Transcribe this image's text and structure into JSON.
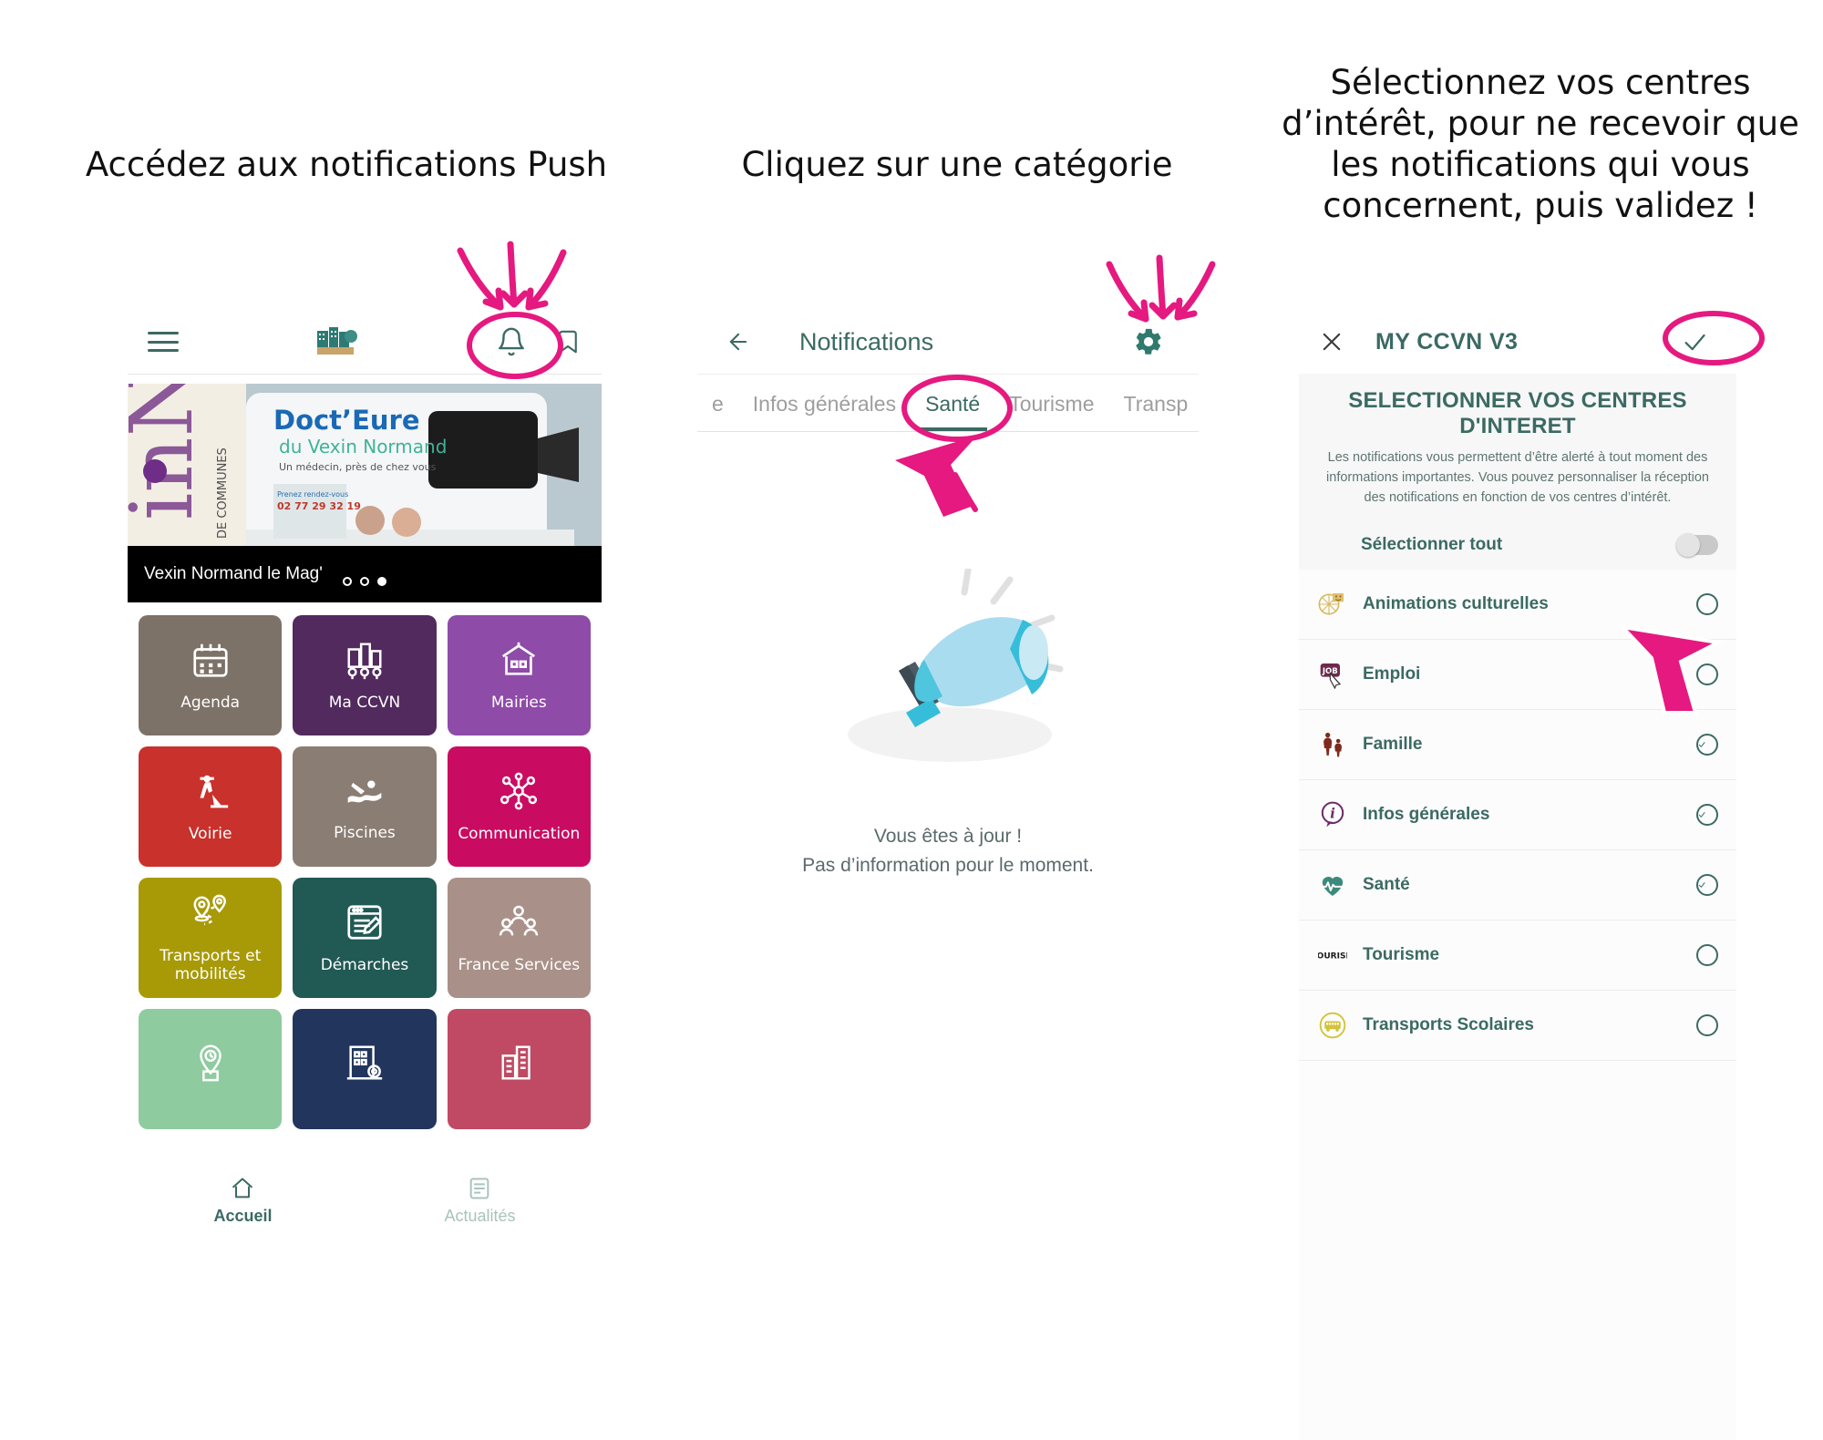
{
  "captions": {
    "step1": "Accédez aux notifications Push",
    "step2": "Cliquez sur une catégorie",
    "step3": "Sélectionnez vos centres d’intérêt, pour ne recevoir que les notifications qui vous concernent, puis validez !"
  },
  "colors": {
    "teal": "#3b6a63",
    "annotation_pink": "#e5197f",
    "tab_inactive": "#9e9e9e"
  },
  "phone1": {
    "hero": {
      "title": "Vexin Normand le Mag'",
      "dots": 3,
      "active_dot": 3
    },
    "tiles": [
      {
        "label": "Agenda",
        "color": "#7d7268",
        "icon": "calendar-icon"
      },
      {
        "label": "Ma CCVN",
        "color": "#522a5e",
        "icon": "city-icon"
      },
      {
        "label": "Mairies",
        "color": "#8e4ba8",
        "icon": "townhall-icon"
      },
      {
        "label": "Voirie",
        "color": "#c9312c",
        "icon": "roadworks-icon"
      },
      {
        "label": "Piscines",
        "color": "#8a7d73",
        "icon": "swimmer-icon"
      },
      {
        "label": "Communication",
        "color": "#c90c62",
        "icon": "network-icon"
      },
      {
        "label": "Transports et mobilités",
        "color": "#a89a07",
        "icon": "route-pin-icon"
      },
      {
        "label": "Démarches",
        "color": "#215954",
        "icon": "form-edit-icon"
      },
      {
        "label": "France Services",
        "color": "#a99189",
        "icon": "people-icon"
      },
      {
        "label": "",
        "color": "#8ecb9f",
        "icon": "pin-clock-icon"
      },
      {
        "label": "",
        "color": "#22365d",
        "icon": "building-icon"
      },
      {
        "label": "",
        "color": "#c04a63",
        "icon": "buildings-icon"
      }
    ],
    "bottom_nav": [
      {
        "label": "Accueil",
        "icon": "home-icon",
        "active": true
      },
      {
        "label": "Actualités",
        "icon": "news-icon",
        "active": false
      }
    ]
  },
  "phone2": {
    "title": "Notifications",
    "tabs": [
      {
        "label": "e",
        "selected": false
      },
      {
        "label": "Infos générales",
        "selected": false
      },
      {
        "label": "Santé",
        "selected": true
      },
      {
        "label": "Tourisme",
        "selected": false
      },
      {
        "label": "Transp",
        "selected": false
      }
    ],
    "empty_state": {
      "line1": "Vous êtes à jour !",
      "line2": "Pas d’information pour le moment.",
      "illustration": "megaphone-illustration"
    }
  },
  "phone3": {
    "title": "MY CCVN V3",
    "heading": "SELECTIONNER VOS CENTRES D'INTERET",
    "description": "Les notifications vous permettent d’être alerté à tout moment des informations importantes. Vous pouvez personnaliser la réception des notifications en fonction de vos centres d’intérêt.",
    "select_all_label": "Sélectionner tout",
    "select_all_on": false,
    "interests": [
      {
        "label": "Animations culturelles",
        "icon": "theatre-masks-icon",
        "selected": false
      },
      {
        "label": "Emploi",
        "icon": "job-cursor-icon",
        "selected": false
      },
      {
        "label": "Famille",
        "icon": "family-icon",
        "selected": true
      },
      {
        "label": "Infos générales",
        "icon": "info-bubble-icon",
        "selected": true
      },
      {
        "label": "Santé",
        "icon": "heart-pulse-icon",
        "selected": true
      },
      {
        "label": "Tourisme",
        "icon": "tourism-icon",
        "selected": false
      },
      {
        "label": "Transports Scolaires",
        "icon": "school-bus-icon",
        "selected": false
      }
    ]
  }
}
